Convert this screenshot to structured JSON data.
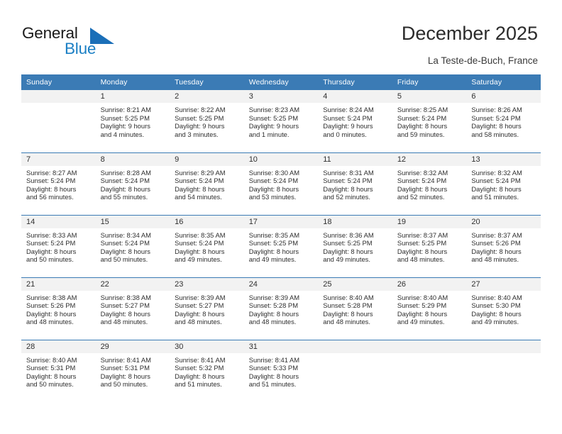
{
  "brand": {
    "name_part1": "General",
    "name_part2": "Blue",
    "logo_icon": "triangle-flag-icon",
    "accent_color": "#1b7fc4"
  },
  "header": {
    "title": "December 2025",
    "subtitle": "La Teste-de-Buch, France"
  },
  "calendar": {
    "header_bg": "#3b7bb5",
    "daynum_bg": "#f2f2f2",
    "weekday_headers": [
      "Sunday",
      "Monday",
      "Tuesday",
      "Wednesday",
      "Thursday",
      "Friday",
      "Saturday"
    ],
    "weeks": [
      [
        {
          "day": "",
          "lines": []
        },
        {
          "day": "1",
          "lines": [
            "Sunrise: 8:21 AM",
            "Sunset: 5:25 PM",
            "Daylight: 9 hours",
            "and 4 minutes."
          ]
        },
        {
          "day": "2",
          "lines": [
            "Sunrise: 8:22 AM",
            "Sunset: 5:25 PM",
            "Daylight: 9 hours",
            "and 3 minutes."
          ]
        },
        {
          "day": "3",
          "lines": [
            "Sunrise: 8:23 AM",
            "Sunset: 5:25 PM",
            "Daylight: 9 hours",
            "and 1 minute."
          ]
        },
        {
          "day": "4",
          "lines": [
            "Sunrise: 8:24 AM",
            "Sunset: 5:24 PM",
            "Daylight: 9 hours",
            "and 0 minutes."
          ]
        },
        {
          "day": "5",
          "lines": [
            "Sunrise: 8:25 AM",
            "Sunset: 5:24 PM",
            "Daylight: 8 hours",
            "and 59 minutes."
          ]
        },
        {
          "day": "6",
          "lines": [
            "Sunrise: 8:26 AM",
            "Sunset: 5:24 PM",
            "Daylight: 8 hours",
            "and 58 minutes."
          ]
        }
      ],
      [
        {
          "day": "7",
          "lines": [
            "Sunrise: 8:27 AM",
            "Sunset: 5:24 PM",
            "Daylight: 8 hours",
            "and 56 minutes."
          ]
        },
        {
          "day": "8",
          "lines": [
            "Sunrise: 8:28 AM",
            "Sunset: 5:24 PM",
            "Daylight: 8 hours",
            "and 55 minutes."
          ]
        },
        {
          "day": "9",
          "lines": [
            "Sunrise: 8:29 AM",
            "Sunset: 5:24 PM",
            "Daylight: 8 hours",
            "and 54 minutes."
          ]
        },
        {
          "day": "10",
          "lines": [
            "Sunrise: 8:30 AM",
            "Sunset: 5:24 PM",
            "Daylight: 8 hours",
            "and 53 minutes."
          ]
        },
        {
          "day": "11",
          "lines": [
            "Sunrise: 8:31 AM",
            "Sunset: 5:24 PM",
            "Daylight: 8 hours",
            "and 52 minutes."
          ]
        },
        {
          "day": "12",
          "lines": [
            "Sunrise: 8:32 AM",
            "Sunset: 5:24 PM",
            "Daylight: 8 hours",
            "and 52 minutes."
          ]
        },
        {
          "day": "13",
          "lines": [
            "Sunrise: 8:32 AM",
            "Sunset: 5:24 PM",
            "Daylight: 8 hours",
            "and 51 minutes."
          ]
        }
      ],
      [
        {
          "day": "14",
          "lines": [
            "Sunrise: 8:33 AM",
            "Sunset: 5:24 PM",
            "Daylight: 8 hours",
            "and 50 minutes."
          ]
        },
        {
          "day": "15",
          "lines": [
            "Sunrise: 8:34 AM",
            "Sunset: 5:24 PM",
            "Daylight: 8 hours",
            "and 50 minutes."
          ]
        },
        {
          "day": "16",
          "lines": [
            "Sunrise: 8:35 AM",
            "Sunset: 5:24 PM",
            "Daylight: 8 hours",
            "and 49 minutes."
          ]
        },
        {
          "day": "17",
          "lines": [
            "Sunrise: 8:35 AM",
            "Sunset: 5:25 PM",
            "Daylight: 8 hours",
            "and 49 minutes."
          ]
        },
        {
          "day": "18",
          "lines": [
            "Sunrise: 8:36 AM",
            "Sunset: 5:25 PM",
            "Daylight: 8 hours",
            "and 49 minutes."
          ]
        },
        {
          "day": "19",
          "lines": [
            "Sunrise: 8:37 AM",
            "Sunset: 5:25 PM",
            "Daylight: 8 hours",
            "and 48 minutes."
          ]
        },
        {
          "day": "20",
          "lines": [
            "Sunrise: 8:37 AM",
            "Sunset: 5:26 PM",
            "Daylight: 8 hours",
            "and 48 minutes."
          ]
        }
      ],
      [
        {
          "day": "21",
          "lines": [
            "Sunrise: 8:38 AM",
            "Sunset: 5:26 PM",
            "Daylight: 8 hours",
            "and 48 minutes."
          ]
        },
        {
          "day": "22",
          "lines": [
            "Sunrise: 8:38 AM",
            "Sunset: 5:27 PM",
            "Daylight: 8 hours",
            "and 48 minutes."
          ]
        },
        {
          "day": "23",
          "lines": [
            "Sunrise: 8:39 AM",
            "Sunset: 5:27 PM",
            "Daylight: 8 hours",
            "and 48 minutes."
          ]
        },
        {
          "day": "24",
          "lines": [
            "Sunrise: 8:39 AM",
            "Sunset: 5:28 PM",
            "Daylight: 8 hours",
            "and 48 minutes."
          ]
        },
        {
          "day": "25",
          "lines": [
            "Sunrise: 8:40 AM",
            "Sunset: 5:28 PM",
            "Daylight: 8 hours",
            "and 48 minutes."
          ]
        },
        {
          "day": "26",
          "lines": [
            "Sunrise: 8:40 AM",
            "Sunset: 5:29 PM",
            "Daylight: 8 hours",
            "and 49 minutes."
          ]
        },
        {
          "day": "27",
          "lines": [
            "Sunrise: 8:40 AM",
            "Sunset: 5:30 PM",
            "Daylight: 8 hours",
            "and 49 minutes."
          ]
        }
      ],
      [
        {
          "day": "28",
          "lines": [
            "Sunrise: 8:40 AM",
            "Sunset: 5:31 PM",
            "Daylight: 8 hours",
            "and 50 minutes."
          ]
        },
        {
          "day": "29",
          "lines": [
            "Sunrise: 8:41 AM",
            "Sunset: 5:31 PM",
            "Daylight: 8 hours",
            "and 50 minutes."
          ]
        },
        {
          "day": "30",
          "lines": [
            "Sunrise: 8:41 AM",
            "Sunset: 5:32 PM",
            "Daylight: 8 hours",
            "and 51 minutes."
          ]
        },
        {
          "day": "31",
          "lines": [
            "Sunrise: 8:41 AM",
            "Sunset: 5:33 PM",
            "Daylight: 8 hours",
            "and 51 minutes."
          ]
        },
        {
          "day": "",
          "lines": []
        },
        {
          "day": "",
          "lines": []
        },
        {
          "day": "",
          "lines": []
        }
      ]
    ]
  }
}
